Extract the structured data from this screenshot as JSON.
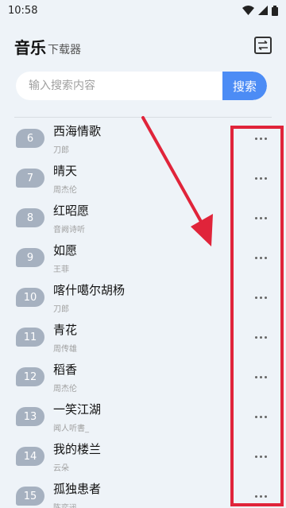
{
  "status_bar": {
    "time": "10:58"
  },
  "header": {
    "title": "音乐",
    "subtitle": "下载器"
  },
  "search": {
    "placeholder": "输入搜索内容",
    "button_label": "搜索"
  },
  "songs": [
    {
      "num": "6",
      "title": "西海情歌",
      "artist": "刀郎"
    },
    {
      "num": "7",
      "title": "晴天",
      "artist": "周杰伦"
    },
    {
      "num": "8",
      "title": "红昭愿",
      "artist": "音阙诗听"
    },
    {
      "num": "9",
      "title": "如愿",
      "artist": "王菲"
    },
    {
      "num": "10",
      "title": "喀什噶尔胡杨",
      "artist": "刀郎"
    },
    {
      "num": "11",
      "title": "青花",
      "artist": "周传雄"
    },
    {
      "num": "12",
      "title": "稻香",
      "artist": "周杰伦"
    },
    {
      "num": "13",
      "title": "一笑江湖",
      "artist": "闻人听書_"
    },
    {
      "num": "14",
      "title": "我的楼兰",
      "artist": "云朵"
    },
    {
      "num": "15",
      "title": "孤独患者",
      "artist": "陈奕迅"
    }
  ],
  "colors": {
    "accent": "#4c8cf5",
    "badge": "#a6b1c0",
    "annotation": "#e0243a",
    "background": "#eef3f8"
  },
  "icons": {
    "wifi": "wifi-icon",
    "signal": "signal-icon",
    "battery": "battery-icon",
    "swap": "swap-icon",
    "more": "more-icon"
  }
}
